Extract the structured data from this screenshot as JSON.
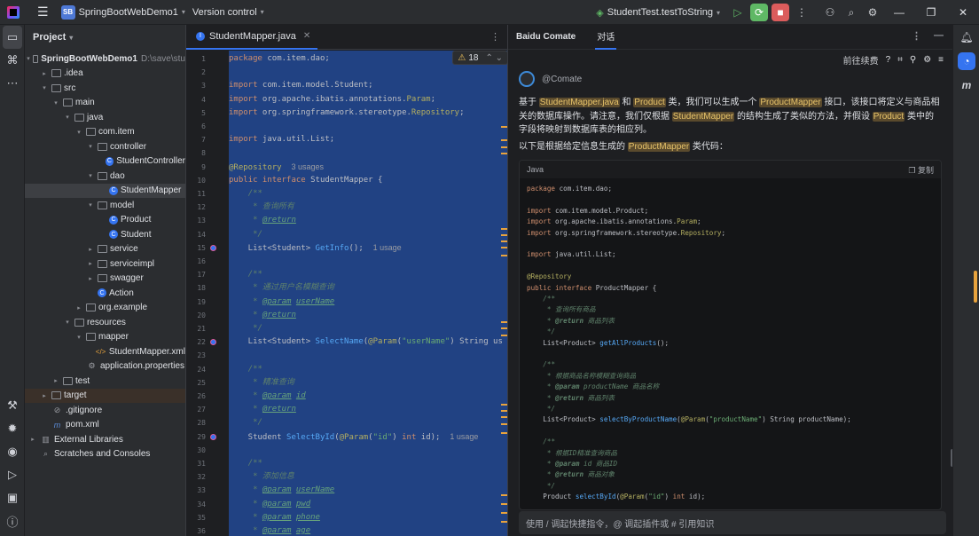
{
  "titlebar": {
    "project_badge": "SB",
    "project_name": "SpringBootWebDemo1",
    "vcs": "Version control",
    "run_config": "StudentTest.testToString"
  },
  "project_panel": {
    "title": "Project",
    "tree": [
      {
        "label": "SpringBootWebDemo1",
        "path": "D:\\save\\stu",
        "indent": 0,
        "arrow": "▾",
        "icon": "folder",
        "bold": true
      },
      {
        "label": ".idea",
        "indent": 1,
        "arrow": "▸",
        "icon": "folder"
      },
      {
        "label": "src",
        "indent": 1,
        "arrow": "▾",
        "icon": "folder"
      },
      {
        "label": "main",
        "indent": 2,
        "arrow": "▾",
        "icon": "folder"
      },
      {
        "label": "java",
        "indent": 3,
        "arrow": "▾",
        "icon": "folder"
      },
      {
        "label": "com.item",
        "indent": 4,
        "arrow": "▾",
        "icon": "folder"
      },
      {
        "label": "controller",
        "indent": 5,
        "arrow": "▾",
        "icon": "folder"
      },
      {
        "label": "StudentController",
        "indent": 6,
        "arrow": "",
        "icon": "class"
      },
      {
        "label": "dao",
        "indent": 5,
        "arrow": "▾",
        "icon": "folder"
      },
      {
        "label": "StudentMapper",
        "indent": 6,
        "arrow": "",
        "icon": "class",
        "selected": true
      },
      {
        "label": "model",
        "indent": 5,
        "arrow": "▾",
        "icon": "folder"
      },
      {
        "label": "Product",
        "indent": 6,
        "arrow": "",
        "icon": "class"
      },
      {
        "label": "Student",
        "indent": 6,
        "arrow": "",
        "icon": "class"
      },
      {
        "label": "service",
        "indent": 5,
        "arrow": "▸",
        "icon": "folder"
      },
      {
        "label": "serviceimpl",
        "indent": 5,
        "arrow": "▸",
        "icon": "folder"
      },
      {
        "label": "swagger",
        "indent": 5,
        "arrow": "▸",
        "icon": "folder"
      },
      {
        "label": "Action",
        "indent": 5,
        "arrow": "",
        "icon": "class"
      },
      {
        "label": "org.example",
        "indent": 4,
        "arrow": "▸",
        "icon": "folder"
      },
      {
        "label": "resources",
        "indent": 3,
        "arrow": "▾",
        "icon": "folder"
      },
      {
        "label": "mapper",
        "indent": 4,
        "arrow": "▾",
        "icon": "folder"
      },
      {
        "label": "StudentMapper.xml",
        "indent": 5,
        "arrow": "",
        "icon": "xml"
      },
      {
        "label": "application.properties",
        "indent": 4,
        "arrow": "",
        "icon": "settings"
      },
      {
        "label": "test",
        "indent": 2,
        "arrow": "▸",
        "icon": "folder"
      },
      {
        "label": "target",
        "indent": 1,
        "arrow": "▸",
        "icon": "folder",
        "highlight": true
      },
      {
        "label": ".gitignore",
        "indent": 1,
        "arrow": "",
        "icon": "git"
      },
      {
        "label": "pom.xml",
        "indent": 1,
        "arrow": "",
        "icon": "maven"
      },
      {
        "label": "External Libraries",
        "indent": 0,
        "arrow": "▸",
        "icon": "library"
      },
      {
        "label": "Scratches and Consoles",
        "indent": 0,
        "arrow": "",
        "icon": "scratch"
      }
    ]
  },
  "editor": {
    "tab_label": "StudentMapper.java",
    "warnings": "18",
    "lines": [
      {
        "n": "1",
        "html": "<span class='kw'>package</span> com.item.dao;"
      },
      {
        "n": "2",
        "html": ""
      },
      {
        "n": "3",
        "html": "<span class='kw'>import</span> com.item.model.Student;"
      },
      {
        "n": "4",
        "html": "<span class='kw'>import</span> org.apache.ibatis.annotations.<span class='ann'>Param</span>;"
      },
      {
        "n": "5",
        "html": "<span class='kw'>import</span> org.springframework.stereotype.<span class='ann'>Repository</span>;"
      },
      {
        "n": "6",
        "html": ""
      },
      {
        "n": "7",
        "html": "<span class='kw'>import</span> java.util.List;"
      },
      {
        "n": "8",
        "html": ""
      },
      {
        "n": "9",
        "html": "<span class='ann'>@Repository</span>  <span class='hint'>3 usages</span>"
      },
      {
        "n": "10",
        "html": "<span class='kw'>public interface</span> StudentMapper {"
      },
      {
        "n": "11",
        "html": "    <span class='doc'>/**</span>"
      },
      {
        "n": "12",
        "html": "<span class='doc'>     * 查询所有</span>"
      },
      {
        "n": "13",
        "html": "<span class='doc'>     * </span><span class='dtag'>@return</span>"
      },
      {
        "n": "14",
        "html": "<span class='doc'>     */</span>"
      },
      {
        "n": "15",
        "html": "    List&lt;Student&gt; <span class='fn'>GetInfo</span>();  <span class='hint'>1 usage</span>"
      },
      {
        "n": "16",
        "html": ""
      },
      {
        "n": "17",
        "html": "    <span class='doc'>/**</span>"
      },
      {
        "n": "18",
        "html": "<span class='doc'>     * 通过用户名模糊查询</span>"
      },
      {
        "n": "19",
        "html": "<span class='doc'>     * </span><span class='dtag'>@param</span> <span class='dtag'>userName</span>"
      },
      {
        "n": "20",
        "html": "<span class='doc'>     * </span><span class='dtag'>@return</span>"
      },
      {
        "n": "21",
        "html": "<span class='doc'>     */</span>"
      },
      {
        "n": "22",
        "html": "    List&lt;Student&gt; <span class='fn'>SelectName</span>(<span class='ann'>@Param</span>(<span class='str'>\"userName\"</span>) String us"
      },
      {
        "n": "23",
        "html": ""
      },
      {
        "n": "24",
        "html": "    <span class='doc'>/**</span>"
      },
      {
        "n": "25",
        "html": "<span class='doc'>     * 精准查询</span>"
      },
      {
        "n": "26",
        "html": "<span class='doc'>     * </span><span class='dtag'>@param</span> <span class='dtag'>id</span>"
      },
      {
        "n": "27",
        "html": "<span class='doc'>     * </span><span class='dtag'>@return</span>"
      },
      {
        "n": "28",
        "html": "<span class='doc'>     */</span>"
      },
      {
        "n": "29",
        "html": "    Student <span class='fn'>SelectById</span>(<span class='ann'>@Param</span>(<span class='str'>\"id\"</span>) <span class='kw'>int</span> id);  <span class='hint'>1 usage</span>"
      },
      {
        "n": "30",
        "html": ""
      },
      {
        "n": "31",
        "html": "    <span class='doc'>/**</span>"
      },
      {
        "n": "32",
        "html": "<span class='doc'>     * 添加信息</span>"
      },
      {
        "n": "33",
        "html": "<span class='doc'>     * </span><span class='dtag'>@param</span> <span class='dtag'>userName</span>"
      },
      {
        "n": "34",
        "html": "<span class='doc'>     * </span><span class='dtag'>@param</span> <span class='dtag'>pwd</span>"
      },
      {
        "n": "35",
        "html": "<span class='doc'>     * </span><span class='dtag'>@param</span> <span class='dtag'>phone</span>"
      },
      {
        "n": "36",
        "html": "<span class='doc'>     * </span><span class='dtag'>@param</span> <span class='dtag'>age</span>"
      }
    ]
  },
  "chat": {
    "title": "Baidu Comate",
    "tab": "对话",
    "goto": "前往续费",
    "bot_name": "@Comate",
    "intro_html": "基于 <span class='chip'>StudentMapper.java</span> 和 <span class='chip'>Product</span> 类，我们可以生成一个 <span class='chip'>ProductMapper</span> 接口，该接口将定义与商品相关的数据库操作。请注意，我们仅根据 <span class='chip'>StudentMapper</span> 的结构生成了类似的方法，并假设 <span class='chip'>Product</span> 类中的字段将映射到数据库表的相应列。",
    "lead_html": "以下是根据给定信息生成的 <span class='chip'>ProductMapper</span> 类代码：",
    "code_lang": "Java",
    "copy": "复制",
    "code_lines": [
      "<span class='kw'>package</span> com.item.dao;",
      "",
      "<span class='kw'>import</span> com.item.model.Product;",
      "<span class='kw'>import</span> org.apache.ibatis.annotations.<span class='ann'>Param</span>;",
      "<span class='kw'>import</span> org.springframework.stereotype.<span class='ann'>Repository</span>;",
      "",
      "<span class='kw'>import</span> java.util.List;",
      "",
      "<span class='ann'>@Repository</span>",
      "<span class='kw'>public interface</span> ProductMapper {",
      "    <span class='doc'>/**</span>",
      "<span class='doc'>     * 查询所有商品</span>",
      "<span class='doc'>     * <b>@return</b> 商品列表</span>",
      "<span class='doc'>     */</span>",
      "    List&lt;Product&gt; <span class='fn'>getAllProducts</span>();",
      "",
      "    <span class='doc'>/**</span>",
      "<span class='doc'>     * 根据商品名称模糊查询商品</span>",
      "<span class='doc'>     * <b>@param</b> productName 商品名称</span>",
      "<span class='doc'>     * <b>@return</b> 商品列表</span>",
      "<span class='doc'>     */</span>",
      "    List&lt;Product&gt; <span class='fn'>selectByProductName</span>(<span class='ann'>@Param</span>(<span class='str'>\"productName\"</span>) String productName);",
      "",
      "    <span class='doc'>/**</span>",
      "<span class='doc'>     * 根据ID精准查询商品</span>",
      "<span class='doc'>     * <b>@param</b> id 商品ID</span>",
      "<span class='doc'>     * <b>@return</b> 商品对象</span>",
      "<span class='doc'>     */</span>",
      "    Product <span class='fn'>selectById</span>(<span class='ann'>@Param</span>(<span class='str'>\"id\"</span>) <span class='kw'>int</span> id);"
    ],
    "input_placeholder": "使用 / 调起快捷指令，@ 调起插件或 # 引用知识"
  }
}
